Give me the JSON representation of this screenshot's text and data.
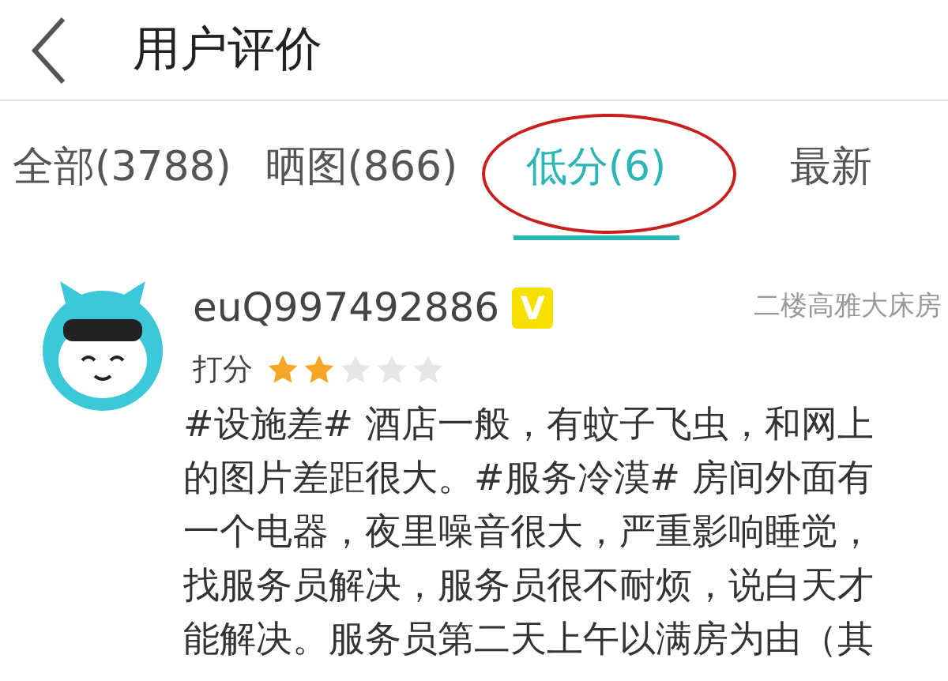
{
  "header": {
    "title": "用户评价"
  },
  "tabs": [
    {
      "label": "全部(3788)",
      "selected": false
    },
    {
      "label": "晒图(866)",
      "selected": false
    },
    {
      "label": "低分(6)",
      "selected": true,
      "circled": true
    },
    {
      "label": "最新",
      "selected": false
    }
  ],
  "review": {
    "username": "euQ997492886",
    "badge": "V",
    "room": "二楼高雅大床房",
    "rating_label": "打分",
    "stars": 2,
    "lines": [
      "#设施差# 酒店一般，有蚊子飞虫，和网上",
      "的图片差距很大。#服务冷漠# 房间外面有",
      "一个电器，夜里噪音很大，严重影响睡觉，",
      "找服务员解决，服务员很不耐烦，说白天才",
      "能解决。服务员第二天上午以满房为由（其"
    ]
  }
}
